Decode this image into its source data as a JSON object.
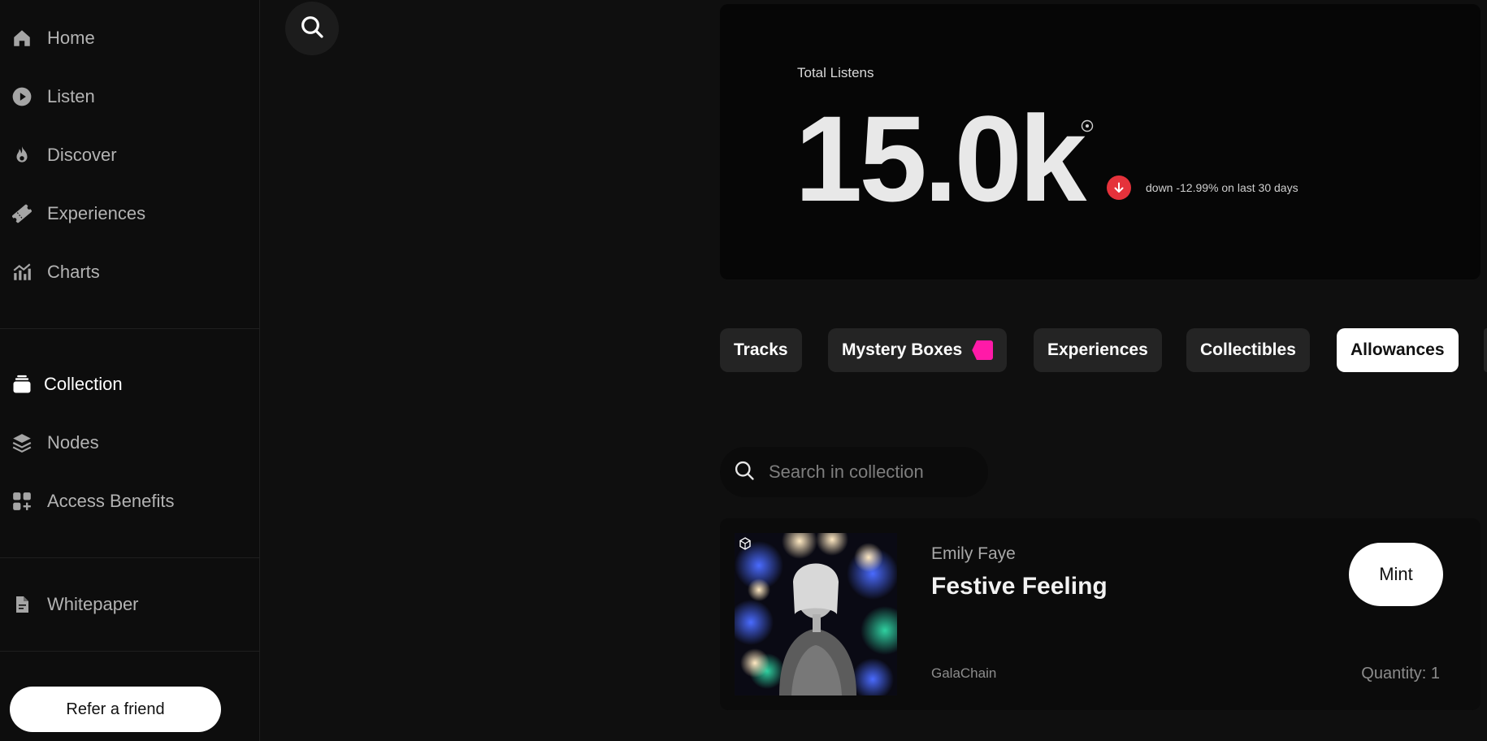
{
  "sidebar": {
    "nav_primary": [
      {
        "label": "Home",
        "icon": "home-icon"
      },
      {
        "label": "Listen",
        "icon": "play-circle-icon"
      },
      {
        "label": "Discover",
        "icon": "flame-icon"
      },
      {
        "label": "Experiences",
        "icon": "ticket-icon"
      },
      {
        "label": "Charts",
        "icon": "chart-icon"
      }
    ],
    "nav_secondary": [
      {
        "label": "Collection",
        "icon": "collection-icon",
        "active": true
      },
      {
        "label": "Nodes",
        "icon": "layers-icon"
      },
      {
        "label": "Access Benefits",
        "icon": "apps-add-icon"
      }
    ],
    "nav_tertiary": [
      {
        "label": "Whitepaper",
        "icon": "document-icon"
      }
    ],
    "refer_label": "Refer a friend"
  },
  "stats": {
    "label": "Total Listens",
    "value": "15.0k",
    "trend_text": "down -12.99% on last 30 days",
    "trend_direction": "down",
    "trend_color": "#e5323b"
  },
  "tabs": [
    {
      "label": "Tracks",
      "active": false
    },
    {
      "label": "Mystery Boxes",
      "active": false,
      "has_tag": true
    },
    {
      "label": "Experiences",
      "active": false
    },
    {
      "label": "Collectibles",
      "active": false
    },
    {
      "label": "Allowances",
      "active": true
    }
  ],
  "collection_search": {
    "placeholder": "Search in collection"
  },
  "item": {
    "artist": "Emily Faye",
    "title": "Festive Feeling",
    "chain": "GalaChain",
    "quantity": "Quantity: 1",
    "action_label": "Mint"
  },
  "colors": {
    "background": "#0f0f0f",
    "accent_tag": "#ff1aa8",
    "trend_down": "#e5323b"
  }
}
